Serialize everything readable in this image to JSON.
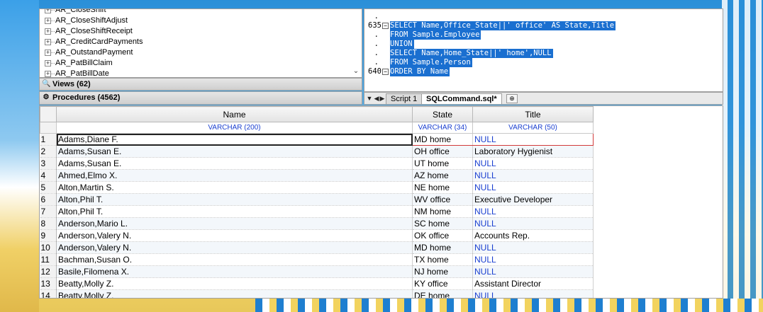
{
  "tree": {
    "items": [
      {
        "label": "AR_CloseShift"
      },
      {
        "label": "AR_CloseShiftAdjust"
      },
      {
        "label": "AR_CloseShiftReceipt"
      },
      {
        "label": "AR_CreditCardPayments"
      },
      {
        "label": "AR_OutstandPayment"
      },
      {
        "label": "AR_PatBillClaim"
      },
      {
        "label": "AR_PatBillDate"
      }
    ],
    "views_label": "Views (62)",
    "procedures_label": "Procedures (4562)"
  },
  "editor": {
    "gutter": [
      {
        "num": "",
        "marker": "."
      },
      {
        "num": "635",
        "marker": "⊟"
      },
      {
        "num": "",
        "marker": "."
      },
      {
        "num": "",
        "marker": "."
      },
      {
        "num": "",
        "marker": "."
      },
      {
        "num": "",
        "marker": "."
      },
      {
        "num": "640",
        "marker": "⊟"
      }
    ],
    "lines": [
      "SELECT Name,Office_State||' office' AS State,Title",
      "FROM Sample.Employee",
      "UNION",
      "SELECT Name,Home_State||' home',NULL",
      "FROM Sample.Person",
      "ORDER BY Name"
    ],
    "tabs": [
      {
        "label": "Script 1"
      },
      {
        "label": "SQLCommand.sql*"
      }
    ]
  },
  "grid": {
    "columns": [
      {
        "name": "Name",
        "type": "VARCHAR (200)"
      },
      {
        "name": "State",
        "type": "VARCHAR (34)"
      },
      {
        "name": "Title",
        "type": "VARCHAR (50)"
      }
    ],
    "rows": [
      {
        "n": "1",
        "name": "Adams,Diane F.",
        "state": "MD home",
        "title": "NULL"
      },
      {
        "n": "2",
        "name": "Adams,Susan E.",
        "state": "OH office",
        "title": "Laboratory Hygienist"
      },
      {
        "n": "3",
        "name": "Adams,Susan E.",
        "state": "UT home",
        "title": "NULL"
      },
      {
        "n": "4",
        "name": "Ahmed,Elmo X.",
        "state": "AZ home",
        "title": "NULL"
      },
      {
        "n": "5",
        "name": "Alton,Martin S.",
        "state": "NE home",
        "title": "NULL"
      },
      {
        "n": "6",
        "name": "Alton,Phil T.",
        "state": "WV office",
        "title": "Executive Developer"
      },
      {
        "n": "7",
        "name": "Alton,Phil T.",
        "state": "NM home",
        "title": "NULL"
      },
      {
        "n": "8",
        "name": "Anderson,Mario L.",
        "state": "SC home",
        "title": "NULL"
      },
      {
        "n": "9",
        "name": "Anderson,Valery N.",
        "state": "OK office",
        "title": "Accounts Rep."
      },
      {
        "n": "10",
        "name": "Anderson,Valery N.",
        "state": "MD home",
        "title": "NULL"
      },
      {
        "n": "11",
        "name": "Bachman,Susan O.",
        "state": "TX home",
        "title": "NULL"
      },
      {
        "n": "12",
        "name": "Basile,Filomena X.",
        "state": "NJ home",
        "title": "NULL"
      },
      {
        "n": "13",
        "name": "Beatty,Molly Z.",
        "state": "KY office",
        "title": "Assistant Director"
      },
      {
        "n": "14",
        "name": "Beatty,Molly Z.",
        "state": "DE home",
        "title": "NULL"
      }
    ]
  },
  "colors": {
    "selection": "#1a6fd0",
    "null_text": "#1a3fd0",
    "type_text": "#1a3fd0",
    "selected_border": "#d23a3a"
  }
}
